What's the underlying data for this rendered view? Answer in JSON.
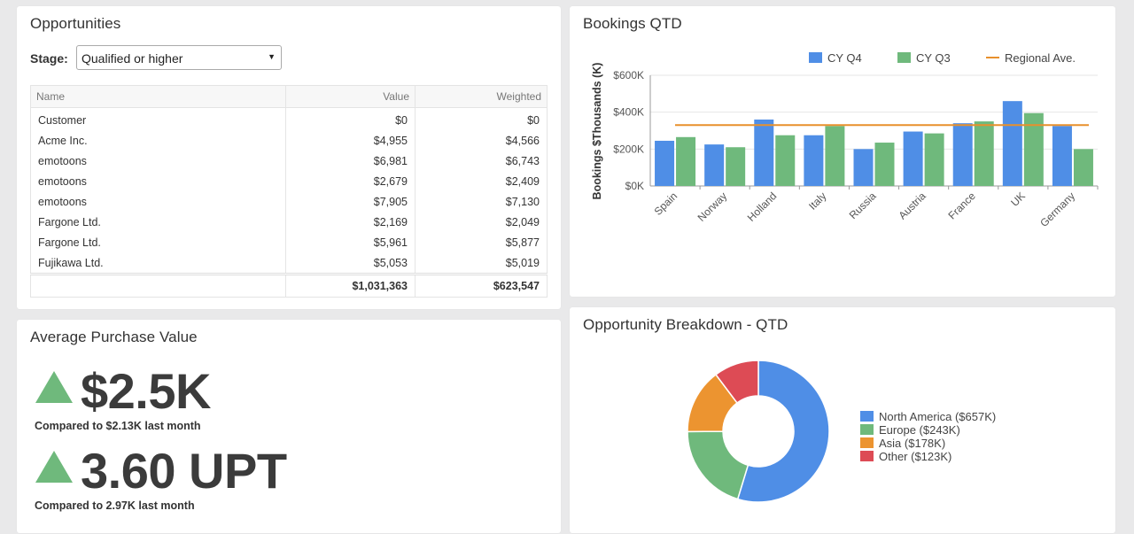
{
  "opportunities": {
    "title": "Opportunities",
    "stage_label": "Stage:",
    "stage_value": "Qualified or higher",
    "columns": [
      "Name",
      "Value",
      "Weighted"
    ],
    "rows": [
      [
        "Customer",
        "$0",
        "$0"
      ],
      [
        "Acme Inc.",
        "$4,955",
        "$4,566"
      ],
      [
        "emotoons",
        "$6,981",
        "$6,743"
      ],
      [
        "emotoons",
        "$2,679",
        "$2,409"
      ],
      [
        "emotoons",
        "$7,905",
        "$7,130"
      ],
      [
        "Fargone Ltd.",
        "$2,169",
        "$2,049"
      ],
      [
        "Fargone Ltd.",
        "$5,961",
        "$5,877"
      ],
      [
        "Fujikawa Ltd.",
        "$5,053",
        "$5,019"
      ]
    ],
    "totals": [
      "",
      "$1,031,363",
      "$623,547"
    ]
  },
  "bookings": {
    "title": "Bookings QTD",
    "legend": [
      "CY Q4",
      "CY Q3",
      "Regional Ave."
    ]
  },
  "average": {
    "title": "Average Purchase Value",
    "kpi1_value": "$2.5K",
    "kpi1_sub": "Compared to $2.13K last month",
    "kpi2_value": "3.60 UPT",
    "kpi2_sub": "Compared to 2.97K last month",
    "trend_color": "#6fb97c"
  },
  "breakdown": {
    "title": "Opportunity Breakdown - QTD"
  },
  "chart_data": [
    {
      "type": "bar",
      "title": "Bookings QTD",
      "ylabel": "Bookings $Thousands (K)",
      "xlabel": "",
      "categories": [
        "Spain",
        "Norway",
        "Holland",
        "Italy",
        "Russia",
        "Austria",
        "France",
        "UK",
        "Germany"
      ],
      "series": [
        {
          "name": "CY Q4",
          "color": "#4f8ee6",
          "values": [
            245,
            225,
            360,
            275,
            200,
            295,
            340,
            460,
            325
          ]
        },
        {
          "name": "CY Q3",
          "color": "#6fb97c",
          "values": [
            265,
            210,
            275,
            325,
            235,
            285,
            350,
            395,
            200
          ]
        }
      ],
      "reference_line": {
        "name": "Regional Ave.",
        "color": "#e8902c",
        "value": 330
      },
      "ylim": [
        0,
        600
      ],
      "yticks": [
        "$0K",
        "$200K",
        "$400K",
        "$600K"
      ],
      "grid": true,
      "legend_position": "top"
    },
    {
      "type": "pie",
      "title": "Opportunity Breakdown - QTD",
      "donut": true,
      "slices": [
        {
          "label": "North America ($657K)",
          "value": 657,
          "color": "#4f8ee6"
        },
        {
          "label": "Europe ($243K)",
          "value": 243,
          "color": "#6fb97c"
        },
        {
          "label": "Asia ($178K)",
          "value": 178,
          "color": "#ec9430"
        },
        {
          "label": "Other ($123K)",
          "value": 123,
          "color": "#dd4b55"
        }
      ],
      "legend_position": "right"
    }
  ]
}
